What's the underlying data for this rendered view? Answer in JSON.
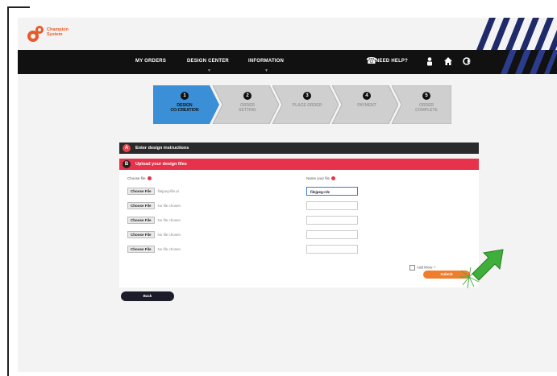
{
  "brand": {
    "line1": "Champion",
    "line2": "System"
  },
  "nav": {
    "items": [
      "MY ORDERS",
      "DESIGN CENTER",
      "INFORMATION"
    ],
    "help": "NEED HELP?"
  },
  "steps": [
    {
      "num": "1",
      "line1": "DESIGN",
      "line2": "CO-CREATION",
      "active": true
    },
    {
      "num": "2",
      "line1": "ORDER",
      "line2": "SETTING",
      "active": false
    },
    {
      "num": "3",
      "line1": "PLACE ORDER",
      "line2": "",
      "active": false
    },
    {
      "num": "4",
      "line1": "PAYMENT",
      "line2": "",
      "active": false
    },
    {
      "num": "5",
      "line1": "ORDER",
      "line2": "COMPLETE",
      "active": false
    }
  ],
  "sections": {
    "enter": {
      "num": "A",
      "label": "Enter design instructions"
    },
    "upload": {
      "num": "B",
      "label": "Upload your design files"
    }
  },
  "upload": {
    "choose_label": "Choose file",
    "name_label": "Name your file",
    "button_label": "Choose File",
    "files": [
      {
        "status": "filejpeg-file.ai",
        "name": "filejpeg-rdz"
      },
      {
        "status": "No file chosen",
        "name": ""
      },
      {
        "status": "No file chosen",
        "name": ""
      },
      {
        "status": "No file chosen",
        "name": ""
      },
      {
        "status": "No file chosen",
        "name": ""
      }
    ],
    "add_more": "Add More +"
  },
  "buttons": {
    "submit": "Submit",
    "back": "Back"
  },
  "colors": {
    "accent_red": "#e6334b",
    "submit_orange": "#ef7d2e",
    "cursor_green": "#3fae3a",
    "navbar": "#111111"
  },
  "icons": [
    "champion-logo-icon",
    "phone-icon",
    "user-icon",
    "home-icon",
    "logout-icon",
    "green-arrow-cursor-icon"
  ]
}
